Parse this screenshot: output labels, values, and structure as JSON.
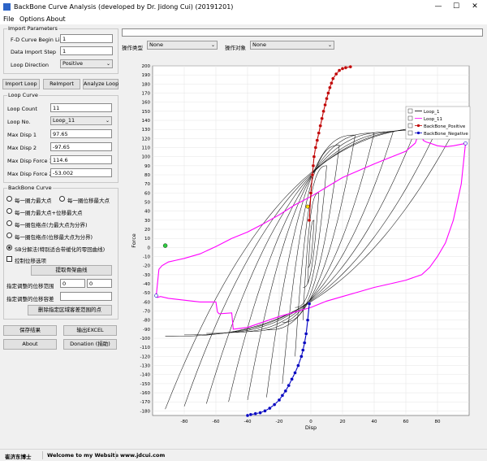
{
  "window": {
    "title": "BackBone Curve Analysis (developed by Dr. Jidong Cui) (20191201)"
  },
  "menu": {
    "items": [
      "File",
      "Options",
      "About"
    ]
  },
  "import": {
    "group_title": "Import Parameters",
    "fd_label": "F-D Curve Begin Line",
    "fd_value": "1",
    "step_label": "Data Import Step",
    "step_value": "1",
    "dir_label": "Loop Direction",
    "dir_value": "Positive"
  },
  "buttons": {
    "import_loop": "Import Loop",
    "reimport": "ReImport",
    "analyze_loop": "Analyze Loop",
    "extract": "提取骨架曲线",
    "delete": "删除指定区域客差范围的点",
    "save": "保存结果",
    "export": "输出EXCEL",
    "about": "About",
    "donation": "Donation (捐助)"
  },
  "loop": {
    "group_title": "Loop Curve",
    "count_label": "Loop Count",
    "count_value": "11",
    "no_label": "Loop No.",
    "no_value": "Loop_11",
    "d1_label": "Max Disp 1",
    "d1_value": "97.65",
    "d2_label": "Max Disp 2",
    "d2_value": "-97.65",
    "f1_label": "Max Disp Force 1",
    "f1_value": "114.6",
    "f2_label": "Max Disp Force 2",
    "f2_value": "-53.002"
  },
  "backbone": {
    "group_title": "BackBone Curve",
    "opt1": "每一圈力最大点",
    "opt2": "每一圈位移最大点",
    "opt3": "每一圈力最大点+位移最大点",
    "opt4": "每一圈包络点(力最大点为分界)",
    "opt5": "每一圈包络点(位移最大点为分界)",
    "opt6": "SB分解法(特别适合带缓化的零回曲线)",
    "control_label": "控制位移选项",
    "range_label": "指定调整的位移范围",
    "range_from": "0",
    "range_to": "0",
    "tol_label": "指定调整的位移容差",
    "tol_value": ""
  },
  "toolbar": {
    "op_type_label": "操作类型",
    "op_type_value": "None",
    "op_obj_label": "操作对象",
    "op_obj_value": "None"
  },
  "status": {
    "author": "崔济东博士",
    "welcome": "Welcome to my Website",
    "website": "www.jdcui.com"
  },
  "colors": {
    "loop_1": "#000000",
    "loop_11": "#ff00ff",
    "positive": "#c00000",
    "negative": "#0000c0"
  },
  "chart_data": {
    "type": "line",
    "xlabel": "Disp",
    "ylabel": "Force",
    "xlim": [
      -100,
      100
    ],
    "ylim": [
      -185,
      200
    ],
    "xticks": [
      -80,
      -60,
      -40,
      -20,
      0,
      20,
      40,
      60,
      80
    ],
    "yticks": [
      200,
      190,
      180,
      170,
      160,
      150,
      140,
      130,
      120,
      110,
      100,
      90,
      80,
      70,
      60,
      50,
      40,
      30,
      20,
      10,
      0,
      -10,
      -20,
      -30,
      -40,
      -50,
      -60,
      -70,
      -80,
      -90,
      -100,
      -110,
      -120,
      -130,
      -140,
      -150,
      -160,
      -170,
      -180
    ],
    "grid": true,
    "legend": {
      "position": "top-right",
      "entries": [
        "Loop_1",
        "Loop_11",
        "BackBone_Positive",
        "BackBone_Negative"
      ]
    },
    "series": [
      {
        "name": "Loop_11",
        "color": "#ff00ff",
        "x": [
          -97.7,
          -97,
          -95,
          -90,
          -70,
          -60,
          -59,
          -58,
          -50,
          -49,
          -40,
          -20,
          0,
          10,
          20,
          30,
          40,
          50,
          60,
          70,
          75,
          80,
          85,
          90,
          95,
          97.7,
          96,
          93,
          90,
          85,
          80,
          75,
          73,
          71,
          70,
          69,
          68,
          67,
          66,
          60,
          50,
          40,
          20,
          0,
          -10,
          -20,
          -30,
          -40,
          -50,
          -60,
          -70,
          -80,
          -85,
          -90,
          -94,
          -96,
          -97.7
        ],
        "y": [
          -53,
          -55,
          -54,
          -56,
          -60,
          -60,
          -71,
          -73,
          -72,
          -90,
          -88,
          -76,
          -66,
          -59,
          -54,
          -49,
          -44,
          -40,
          -36,
          -30,
          -22,
          -10,
          5,
          30,
          70,
          114.6,
          114,
          113,
          112,
          111,
          112,
          115,
          116,
          118,
          127,
          128,
          128,
          120,
          115,
          106,
          99,
          92,
          77,
          56,
          47,
          36,
          26,
          17,
          10,
          1,
          -7,
          -12,
          -14,
          -16,
          -20,
          -24,
          -53
        ]
      },
      {
        "name": "BackBone_Positive",
        "color": "#c00000",
        "x": [
          -1,
          0,
          1,
          1.5,
          2,
          3,
          4,
          5,
          6,
          7,
          8,
          9,
          10,
          11,
          12,
          13,
          14,
          16,
          18,
          20,
          22,
          25
        ],
        "y": [
          30,
          60,
          80,
          90,
          100,
          110,
          118,
          126,
          134,
          142,
          150,
          157,
          164,
          170,
          176,
          181,
          186,
          191,
          195,
          197,
          198,
          199
        ]
      },
      {
        "name": "BackBone_Negative",
        "color": "#0000c0",
        "x": [
          -40,
          -38,
          -35,
          -32,
          -29,
          -26,
          -23,
          -20,
          -18,
          -16,
          -14,
          -12,
          -10,
          -8,
          -6,
          -5,
          -4,
          -3,
          -2,
          -1
        ],
        "y": [
          -185,
          -184,
          -183,
          -182,
          -180,
          -177,
          -173,
          -168,
          -163,
          -158,
          -152,
          -145,
          -138,
          -130,
          -120,
          -113,
          -105,
          -95,
          -80,
          -62
        ]
      }
    ]
  }
}
